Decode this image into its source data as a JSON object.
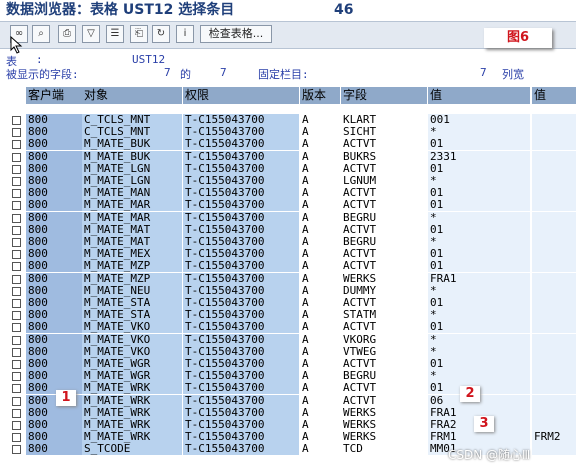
{
  "title": {
    "text": "数据浏览器：表格 UST12 选择条目",
    "count": "46"
  },
  "toolbar": {
    "buttons": [
      "glasses-icon",
      "find-icon",
      "print-icon",
      "filter-icon",
      "details-icon",
      "export-icon",
      "refresh-icon",
      "info-icon"
    ],
    "check_table_label": "检查表格..."
  },
  "figure_label": "图6",
  "info": {
    "table_label": "表",
    "table_sep": ":",
    "table_name": "UST12",
    "displayed_fields_label": "被显示的字段:",
    "displayed_fields_count": "7",
    "of_label": "的",
    "total_fields": "7",
    "fixed_columns_label": "固定栏目:",
    "fixed_columns_value": "7",
    "column_width_label": "列宽"
  },
  "columns": {
    "client": "客户端",
    "object": "对象",
    "auth": "权限",
    "version": "版本",
    "field": "字段",
    "value": "值",
    "value2": "值"
  },
  "rows": [
    {
      "client": "800",
      "object": "C_TCLS_MNT",
      "auth": "T-C155043700",
      "version": "A",
      "field": "KLART",
      "value": "001",
      "value2": ""
    },
    {
      "client": "800",
      "object": "C_TCLS_MNT",
      "auth": "T-C155043700",
      "version": "A",
      "field": "SICHT",
      "value": "*",
      "value2": ""
    },
    {
      "client": "800",
      "object": "M_MATE_BUK",
      "auth": "T-C155043700",
      "version": "A",
      "field": "ACTVT",
      "value": "01",
      "value2": ""
    },
    {
      "client": "800",
      "object": "M_MATE_BUK",
      "auth": "T-C155043700",
      "version": "A",
      "field": "BUKRS",
      "value": "2331",
      "value2": ""
    },
    {
      "client": "800",
      "object": "M_MATE_LGN",
      "auth": "T-C155043700",
      "version": "A",
      "field": "ACTVT",
      "value": "01",
      "value2": ""
    },
    {
      "client": "800",
      "object": "M_MATE_LGN",
      "auth": "T-C155043700",
      "version": "A",
      "field": "LGNUM",
      "value": "*",
      "value2": ""
    },
    {
      "client": "800",
      "object": "M_MATE_MAN",
      "auth": "T-C155043700",
      "version": "A",
      "field": "ACTVT",
      "value": "01",
      "value2": ""
    },
    {
      "client": "800",
      "object": "M_MATE_MAR",
      "auth": "T-C155043700",
      "version": "A",
      "field": "ACTVT",
      "value": "01",
      "value2": ""
    },
    {
      "client": "800",
      "object": "M_MATE_MAR",
      "auth": "T-C155043700",
      "version": "A",
      "field": "BEGRU",
      "value": "*",
      "value2": ""
    },
    {
      "client": "800",
      "object": "M_MATE_MAT",
      "auth": "T-C155043700",
      "version": "A",
      "field": "ACTVT",
      "value": "01",
      "value2": ""
    },
    {
      "client": "800",
      "object": "M_MATE_MAT",
      "auth": "T-C155043700",
      "version": "A",
      "field": "BEGRU",
      "value": "*",
      "value2": ""
    },
    {
      "client": "800",
      "object": "M_MATE_MEX",
      "auth": "T-C155043700",
      "version": "A",
      "field": "ACTVT",
      "value": "01",
      "value2": ""
    },
    {
      "client": "800",
      "object": "M_MATE_MZP",
      "auth": "T-C155043700",
      "version": "A",
      "field": "ACTVT",
      "value": "01",
      "value2": ""
    },
    {
      "client": "800",
      "object": "M_MATE_MZP",
      "auth": "T-C155043700",
      "version": "A",
      "field": "WERKS",
      "value": "FRA1",
      "value2": ""
    },
    {
      "client": "800",
      "object": "M_MATE_NEU",
      "auth": "T-C155043700",
      "version": "A",
      "field": "DUMMY",
      "value": "*",
      "value2": ""
    },
    {
      "client": "800",
      "object": "M_MATE_STA",
      "auth": "T-C155043700",
      "version": "A",
      "field": "ACTVT",
      "value": "01",
      "value2": ""
    },
    {
      "client": "800",
      "object": "M_MATE_STA",
      "auth": "T-C155043700",
      "version": "A",
      "field": "STATM",
      "value": "*",
      "value2": ""
    },
    {
      "client": "800",
      "object": "M_MATE_VKO",
      "auth": "T-C155043700",
      "version": "A",
      "field": "ACTVT",
      "value": "01",
      "value2": ""
    },
    {
      "client": "800",
      "object": "M_MATE_VKO",
      "auth": "T-C155043700",
      "version": "A",
      "field": "VKORG",
      "value": "*",
      "value2": ""
    },
    {
      "client": "800",
      "object": "M_MATE_VKO",
      "auth": "T-C155043700",
      "version": "A",
      "field": "VTWEG",
      "value": "*",
      "value2": ""
    },
    {
      "client": "800",
      "object": "M_MATE_WGR",
      "auth": "T-C155043700",
      "version": "A",
      "field": "ACTVT",
      "value": "01",
      "value2": ""
    },
    {
      "client": "800",
      "object": "M_MATE_WGR",
      "auth": "T-C155043700",
      "version": "A",
      "field": "BEGRU",
      "value": "*",
      "value2": ""
    },
    {
      "client": "800",
      "object": "M_MATE_WRK",
      "auth": "T-C155043700",
      "version": "A",
      "field": "ACTVT",
      "value": "01",
      "value2": ""
    },
    {
      "client": "800",
      "object": "M_MATE_WRK",
      "auth": "T-C155043700",
      "version": "A",
      "field": "ACTVT",
      "value": "06",
      "value2": ""
    },
    {
      "client": "800",
      "object": "M_MATE_WRK",
      "auth": "T-C155043700",
      "version": "A",
      "field": "WERKS",
      "value": "FRA1",
      "value2": ""
    },
    {
      "client": "800",
      "object": "M_MATE_WRK",
      "auth": "T-C155043700",
      "version": "A",
      "field": "WERKS",
      "value": "FRA2",
      "value2": ""
    },
    {
      "client": "800",
      "object": "M_MATE_WRK",
      "auth": "T-C155043700",
      "version": "A",
      "field": "WERKS",
      "value": "FRM1",
      "value2": "FRM2"
    },
    {
      "client": "800",
      "object": "S_TCODE",
      "auth": "T-C155043700",
      "version": "A",
      "field": "TCD",
      "value": "MM01",
      "value2": ""
    }
  ],
  "badges": [
    "1",
    "2",
    "3"
  ],
  "watermark": "CSDN @随心Ⅲ"
}
